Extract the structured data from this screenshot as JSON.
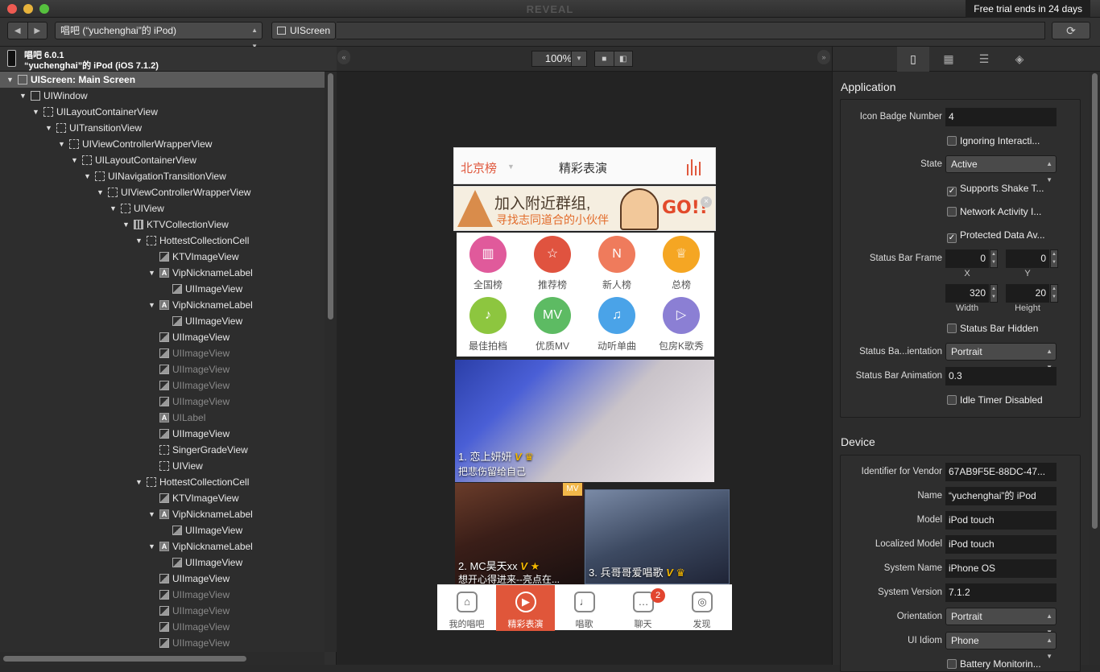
{
  "window": {
    "title": "REVEAL",
    "trial_banner": "Free trial ends in 24 days"
  },
  "toolbar": {
    "device": "唱吧 (“yuchenghai”的 iPod)",
    "breadcrumb": "UIScreen",
    "refresh_icon": "refresh-icon"
  },
  "device_info": {
    "app": "唱吧 6.0.1",
    "device": "“yuchenghai”的 iPod (iOS 7.1.2)"
  },
  "tree": [
    {
      "label": "UIScreen: Main Screen",
      "depth": 0,
      "icon": "box",
      "selected": true,
      "expand": true
    },
    {
      "label": "UIWindow",
      "depth": 1,
      "icon": "box",
      "expand": true
    },
    {
      "label": "UILayoutContainerView",
      "depth": 2,
      "icon": "dash",
      "expand": true
    },
    {
      "label": "UITransitionView",
      "depth": 3,
      "icon": "dash",
      "expand": true
    },
    {
      "label": "UIViewControllerWrapperView",
      "depth": 4,
      "icon": "dash",
      "expand": true
    },
    {
      "label": "UILayoutContainerView",
      "depth": 5,
      "icon": "dash",
      "expand": true
    },
    {
      "label": "UINavigationTransitionView",
      "depth": 6,
      "icon": "dash",
      "expand": true
    },
    {
      "label": "UIViewControllerWrapperView",
      "depth": 7,
      "icon": "dash",
      "expand": true
    },
    {
      "label": "UIView",
      "depth": 8,
      "icon": "dash",
      "expand": true
    },
    {
      "label": "KTVCollectionView",
      "depth": 9,
      "icon": "grid",
      "expand": true
    },
    {
      "label": "HottestCollectionCell",
      "depth": 10,
      "icon": "dash",
      "expand": true
    },
    {
      "label": "KTVImageView",
      "depth": 11,
      "icon": "img"
    },
    {
      "label": "VipNicknameLabel",
      "depth": 11,
      "icon": "lbl",
      "expand": true
    },
    {
      "label": "UIImageView",
      "depth": 12,
      "icon": "img"
    },
    {
      "label": "VipNicknameLabel",
      "depth": 11,
      "icon": "lbl",
      "expand": true
    },
    {
      "label": "UIImageView",
      "depth": 12,
      "icon": "img"
    },
    {
      "label": "UIImageView",
      "depth": 11,
      "icon": "img"
    },
    {
      "label": "UIImageView",
      "depth": 11,
      "icon": "img",
      "dim": true
    },
    {
      "label": "UIImageView",
      "depth": 11,
      "icon": "img",
      "dim": true
    },
    {
      "label": "UIImageView",
      "depth": 11,
      "icon": "img",
      "dim": true
    },
    {
      "label": "UIImageView",
      "depth": 11,
      "icon": "img",
      "dim": true
    },
    {
      "label": "UILabel",
      "depth": 11,
      "icon": "lbl",
      "dim": true
    },
    {
      "label": "UIImageView",
      "depth": 11,
      "icon": "img"
    },
    {
      "label": "SingerGradeView",
      "depth": 11,
      "icon": "dash"
    },
    {
      "label": "UIView",
      "depth": 11,
      "icon": "dash"
    },
    {
      "label": "HottestCollectionCell",
      "depth": 10,
      "icon": "dash",
      "expand": true
    },
    {
      "label": "KTVImageView",
      "depth": 11,
      "icon": "img"
    },
    {
      "label": "VipNicknameLabel",
      "depth": 11,
      "icon": "lbl",
      "expand": true
    },
    {
      "label": "UIImageView",
      "depth": 12,
      "icon": "img"
    },
    {
      "label": "VipNicknameLabel",
      "depth": 11,
      "icon": "lbl",
      "expand": true
    },
    {
      "label": "UIImageView",
      "depth": 12,
      "icon": "img"
    },
    {
      "label": "UIImageView",
      "depth": 11,
      "icon": "img"
    },
    {
      "label": "UIImageView",
      "depth": 11,
      "icon": "img",
      "dim": true
    },
    {
      "label": "UIImageView",
      "depth": 11,
      "icon": "img",
      "dim": true
    },
    {
      "label": "UIImageView",
      "depth": 11,
      "icon": "img",
      "dim": true
    },
    {
      "label": "UIImageView",
      "depth": 11,
      "icon": "img",
      "dim": true
    }
  ],
  "canvas": {
    "zoom": "100%"
  },
  "phone": {
    "nav_left": "北京榜",
    "nav_title": "精彩表演",
    "banner_text1": "加入附近群组,",
    "banner_text2": "寻找志同道合的小伙伴",
    "banner_go": "GO!!",
    "categories": [
      {
        "label": "全国榜",
        "color": "#e05a9b",
        "icon": "▥"
      },
      {
        "label": "推荐榜",
        "color": "#e0533f",
        "icon": "☆"
      },
      {
        "label": "新人榜",
        "color": "#ef7b5c",
        "icon": "N"
      },
      {
        "label": "总榜",
        "color": "#f5a623",
        "icon": "♕"
      },
      {
        "label": "最佳拍档",
        "color": "#8dc63f",
        "icon": "♪"
      },
      {
        "label": "优质MV",
        "color": "#5dbb63",
        "icon": "MV"
      },
      {
        "label": "动听单曲",
        "color": "#4aa3e8",
        "icon": "♫"
      },
      {
        "label": "包房K歌秀",
        "color": "#8b7fd4",
        "icon": "▷"
      }
    ],
    "photo1": {
      "caption": "1. 恋上妍妍",
      "sub": "把悲伤留给自己"
    },
    "photo2": {
      "caption": "2. MC昊天xx",
      "sub": "想开心得进来--亮点在...",
      "tag": "MV"
    },
    "photo3": {
      "caption": "3. 兵哥哥爱唱歌"
    },
    "tabs": [
      {
        "label": "我的唱吧",
        "icon": "⌂"
      },
      {
        "label": "精彩表演",
        "icon": "▶",
        "active": true
      },
      {
        "label": "唱歌",
        "icon": "♩"
      },
      {
        "label": "聊天",
        "icon": "…",
        "badge": "2"
      },
      {
        "label": "发现",
        "icon": "◎"
      }
    ]
  },
  "inspector": {
    "application_title": "Application",
    "icon_badge_label": "Icon Badge Number",
    "icon_badge_value": "4",
    "ignoring_label": "Ignoring Interacti...",
    "state_label": "State",
    "state_value": "Active",
    "supports_shake_label": "Supports Shake T...",
    "network_activity_label": "Network Activity I...",
    "protected_data_label": "Protected Data Av...",
    "status_bar_frame_label": "Status Bar Frame",
    "frame": {
      "x": "0",
      "y": "0",
      "width": "320",
      "height": "20",
      "x_cap": "X",
      "y_cap": "Y",
      "w_cap": "Width",
      "h_cap": "Height"
    },
    "status_bar_hidden_label": "Status Bar Hidden",
    "status_bar_orientation_label": "Status Ba...ientation",
    "status_bar_orientation_value": "Portrait",
    "status_bar_animation_label": "Status Bar Animation",
    "status_bar_animation_value": "0.3",
    "idle_timer_label": "Idle Timer Disabled",
    "device_title": "Device",
    "vendor_label": "Identifier for Vendor",
    "vendor_value": "67AB9F5E-88DC-47...",
    "name_label": "Name",
    "name_value": "“yuchenghai”的 iPod",
    "model_label": "Model",
    "model_value": "iPod touch",
    "localized_model_label": "Localized Model",
    "localized_model_value": "iPod touch",
    "system_name_label": "System Name",
    "system_name_value": "iPhone OS",
    "system_version_label": "System Version",
    "system_version_value": "7.1.2",
    "orientation_label": "Orientation",
    "orientation_value": "Portrait",
    "idiom_label": "UI Idiom",
    "idiom_value": "Phone",
    "battery_label": "Battery Monitorin..."
  }
}
